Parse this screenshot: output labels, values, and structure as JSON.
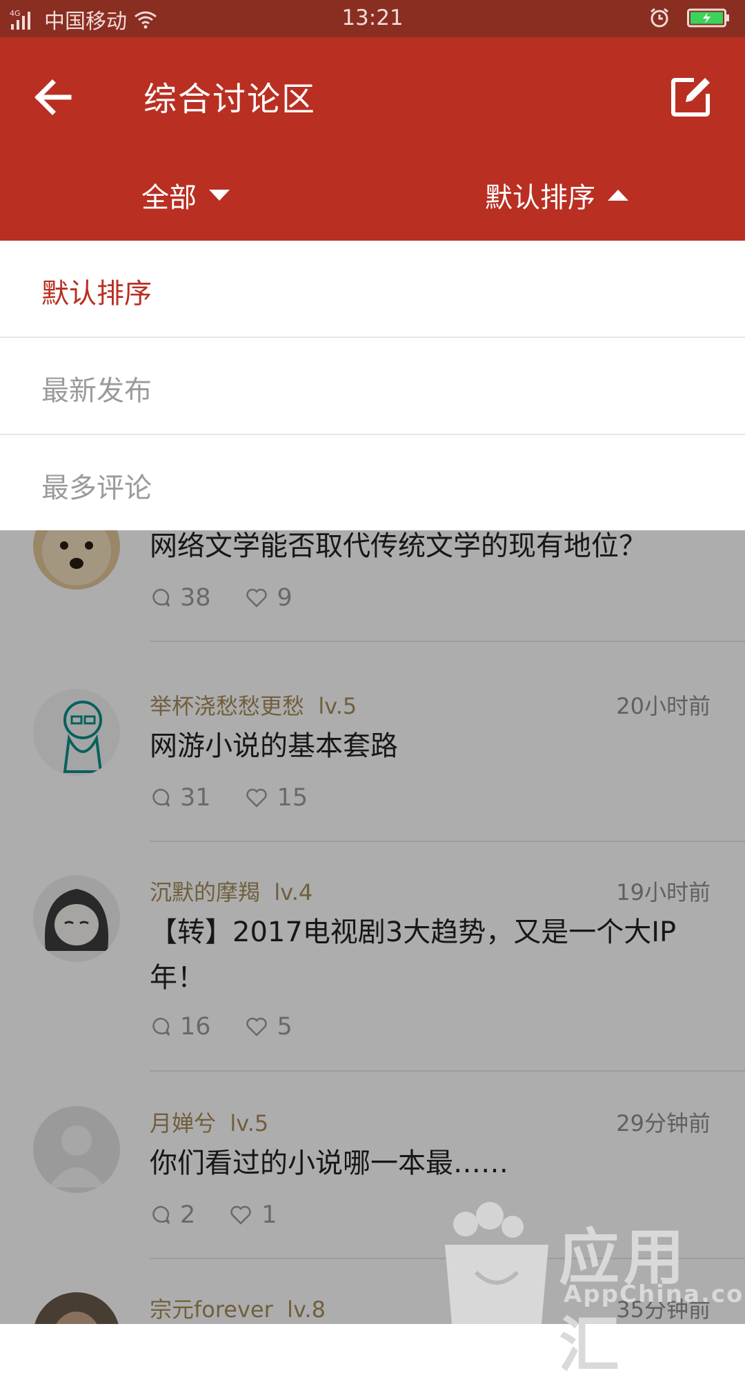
{
  "status_bar": {
    "network": "4G",
    "carrier": "中国移动",
    "time": "13:21",
    "icons": [
      "signal-icon",
      "wifi-icon",
      "alarm-icon",
      "battery-charging-icon"
    ]
  },
  "app_bar": {
    "title": "综合讨论区",
    "back_icon": "back-arrow-icon",
    "edit_icon": "compose-icon",
    "filter_label": "全部",
    "sort_label": "默认排序",
    "background_color": "#b92f22"
  },
  "sort_menu": {
    "items": [
      {
        "label": "默认排序",
        "selected": true
      },
      {
        "label": "最新发布",
        "selected": false
      },
      {
        "label": "最多评论",
        "selected": false
      }
    ],
    "selected_color": "#b92f22"
  },
  "posts": [
    {
      "user": "",
      "level": "",
      "time": "",
      "title": "网络文学能否取代传统文学的现有地位？",
      "comments": "38",
      "likes": "9",
      "avatar": "dog-avatar"
    },
    {
      "user": "举杯浇愁愁更愁",
      "level": "lv.5",
      "time": "20小时前",
      "title": "网游小说的基本套路",
      "comments": "31",
      "likes": "15",
      "avatar": "cartoon-boy-avatar"
    },
    {
      "user": "沉默的摩羯",
      "level": "lv.4",
      "time": "19小时前",
      "title": "【转】2017电视剧3大趋势，又是一个大IP年！",
      "comments": "16",
      "likes": "5",
      "avatar": "anime-girl-avatar"
    },
    {
      "user": "月婵兮",
      "level": "lv.5",
      "time": "29分钟前",
      "title": "你们看过的小说哪一本最……",
      "comments": "2",
      "likes": "1",
      "avatar": "default-avatar"
    },
    {
      "user": "宗元forever",
      "level": "lv.8",
      "time": "35分钟前",
      "title": "",
      "comments": "",
      "likes": "",
      "avatar": "photo-avatar"
    }
  ],
  "watermark": {
    "brand": "应用汇",
    "sub": "AppChina.com"
  }
}
